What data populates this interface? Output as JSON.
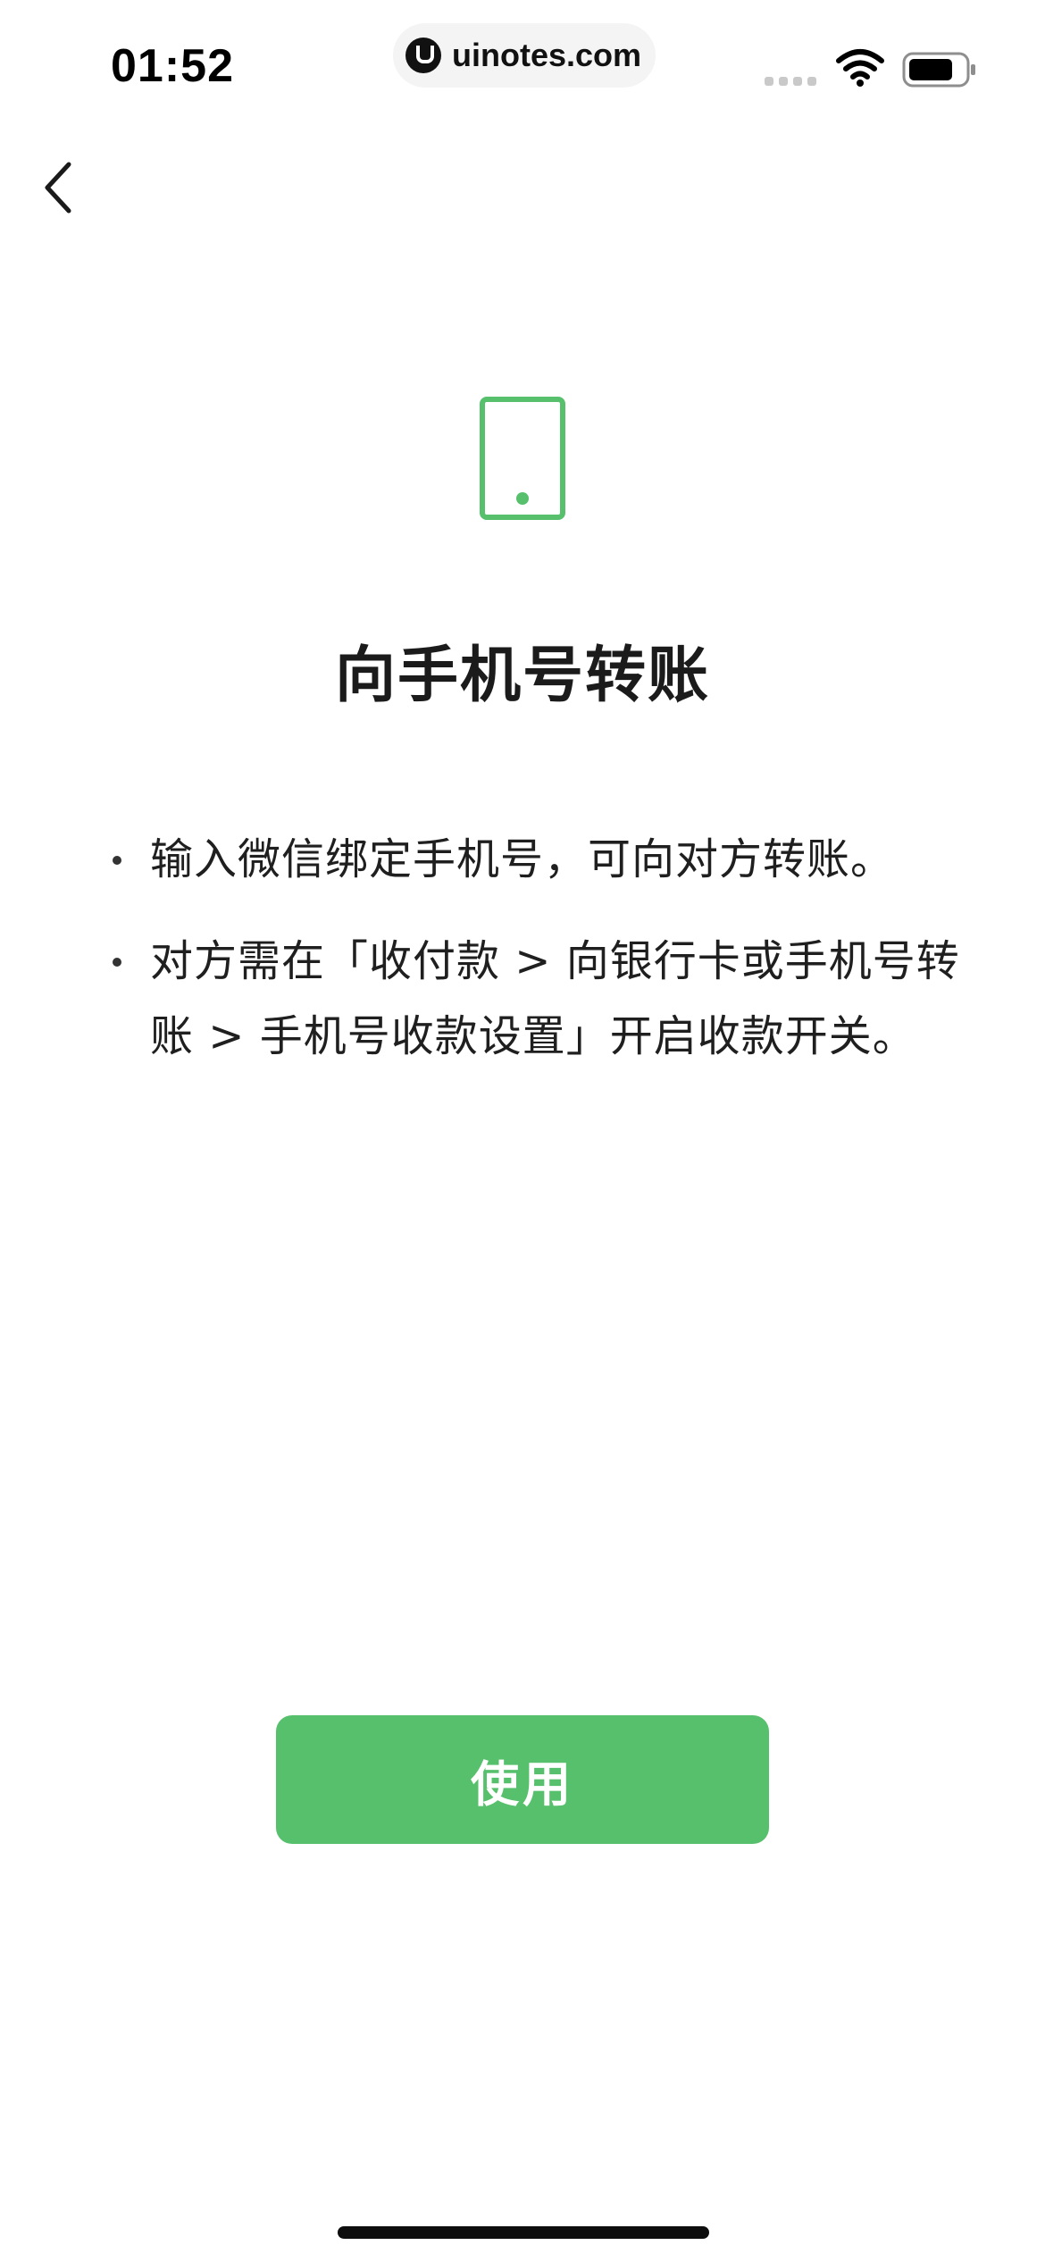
{
  "status_bar": {
    "time": "01:52",
    "watermark": "uinotes.com",
    "icons": [
      "cellular-signal-icon",
      "wifi-icon",
      "battery-icon"
    ]
  },
  "nav": {
    "back_icon": "chevron-left-icon"
  },
  "hero": {
    "illustration_icon": "mobile-phone-icon",
    "title": "向手机号转账"
  },
  "notes": [
    {
      "text": "输入微信绑定手机号，可向对方转账。"
    },
    {
      "text": "对方需在「收付款 > 向银行卡或手机号转账 > 手机号收款设置」开启收款开关。"
    }
  ],
  "actions": {
    "use_label": "使用"
  },
  "colors": {
    "accent": "#57c06c",
    "text": "#1b1b1b",
    "background": "#ffffff"
  }
}
